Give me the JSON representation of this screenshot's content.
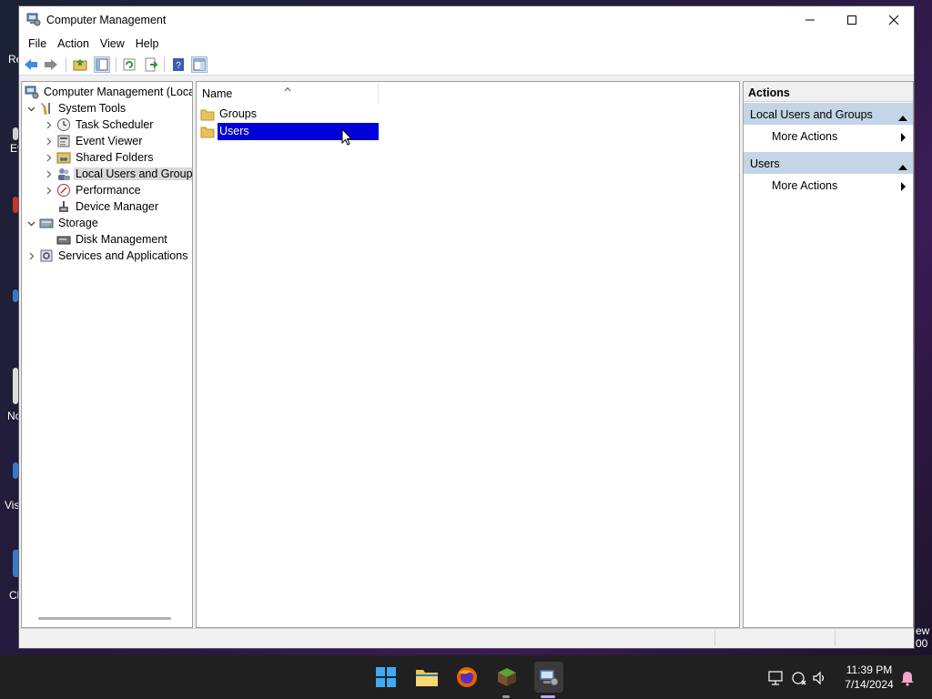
{
  "window": {
    "title": "Computer Management"
  },
  "menu": [
    "File",
    "Action",
    "View",
    "Help"
  ],
  "toolbar": {
    "buttons": [
      "back-icon",
      "forward-icon",
      "up-folder-icon",
      "show-hide-tree-icon",
      "refresh-icon",
      "export-list-icon",
      "help-icon",
      "show-hide-action-pane-icon"
    ]
  },
  "tree": {
    "root": "Computer Management (Local",
    "system_tools": "System Tools",
    "task_scheduler": "Task Scheduler",
    "event_viewer": "Event Viewer",
    "shared_folders": "Shared Folders",
    "local_users": "Local Users and Groups",
    "performance": "Performance",
    "device_manager": "Device Manager",
    "storage": "Storage",
    "disk_management": "Disk Management",
    "services": "Services and Applications"
  },
  "list": {
    "column_name": "Name",
    "items": [
      "Groups",
      "Users"
    ]
  },
  "actions": {
    "header": "Actions",
    "section1": "Local Users and Groups",
    "section1_item": "More Actions",
    "section2": "Users",
    "section2_item": "More Actions"
  },
  "taskbar": {
    "time": "11:39 PM",
    "date": "7/14/2024"
  },
  "desktop": {
    "peek_re": "Re",
    "peek_ev": "Ev",
    "peek_no": "No",
    "peek_vis": "Vis",
    "peek_cl": "Cl",
    "peek_ew": "ew",
    "peek_00": "00"
  },
  "colors": {
    "selection": "#0000d8",
    "action_section": "#c3d5e6",
    "taskbar": "#202020",
    "folder": "#e8c25c"
  }
}
